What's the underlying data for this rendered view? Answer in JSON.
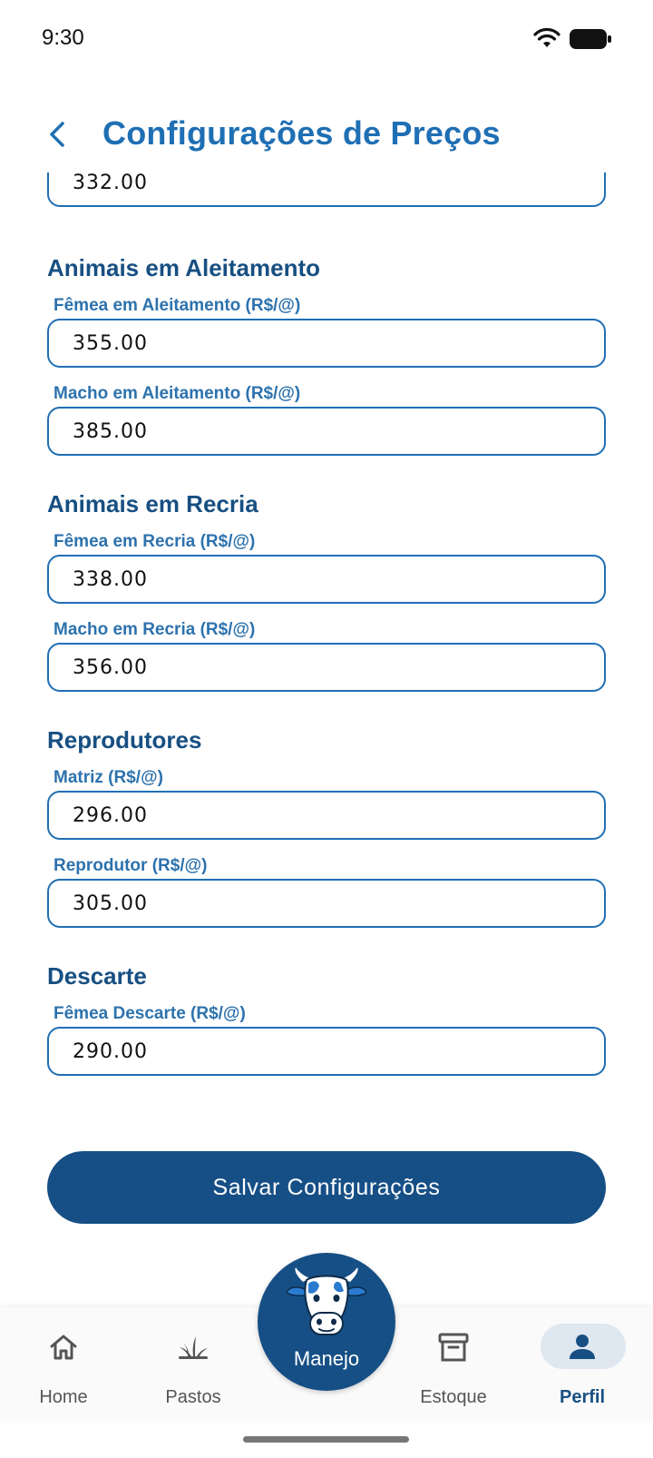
{
  "status_bar": {
    "time": "9:30"
  },
  "header": {
    "title": "Configurações de Preços"
  },
  "partial_field": {
    "value": "332.00"
  },
  "sections": [
    {
      "title": "Animais em Aleitamento",
      "fields": [
        {
          "label": "Fêmea em Aleitamento (R$/@)",
          "value": "355.00"
        },
        {
          "label": "Macho em Aleitamento (R$/@)",
          "value": "385.00"
        }
      ]
    },
    {
      "title": "Animais em Recria",
      "fields": [
        {
          "label": "Fêmea em Recria (R$/@)",
          "value": "338.00"
        },
        {
          "label": "Macho em Recria (R$/@)",
          "value": "356.00"
        }
      ]
    },
    {
      "title": "Reprodutores",
      "fields": [
        {
          "label": "Matriz (R$/@)",
          "value": "296.00"
        },
        {
          "label": "Reprodutor (R$/@)",
          "value": "305.00"
        }
      ]
    },
    {
      "title": "Descarte",
      "fields": [
        {
          "label": "Fêmea Descarte (R$/@)",
          "value": "290.00"
        }
      ]
    }
  ],
  "save_button": {
    "label": "Salvar Configurações"
  },
  "bottom_nav": {
    "items": [
      {
        "label": "Home",
        "icon": "home-icon"
      },
      {
        "label": "Pastos",
        "icon": "grass-icon"
      },
      {
        "label": "Manejo",
        "icon": "cow-icon"
      },
      {
        "label": "Estoque",
        "icon": "archive-icon"
      },
      {
        "label": "Perfil",
        "icon": "person-icon",
        "active": true
      }
    ]
  },
  "colors": {
    "primary": "#164f85",
    "accent": "#1f6fb4",
    "title": "#1f6fb4",
    "active_pill": "#dfe7f1"
  }
}
